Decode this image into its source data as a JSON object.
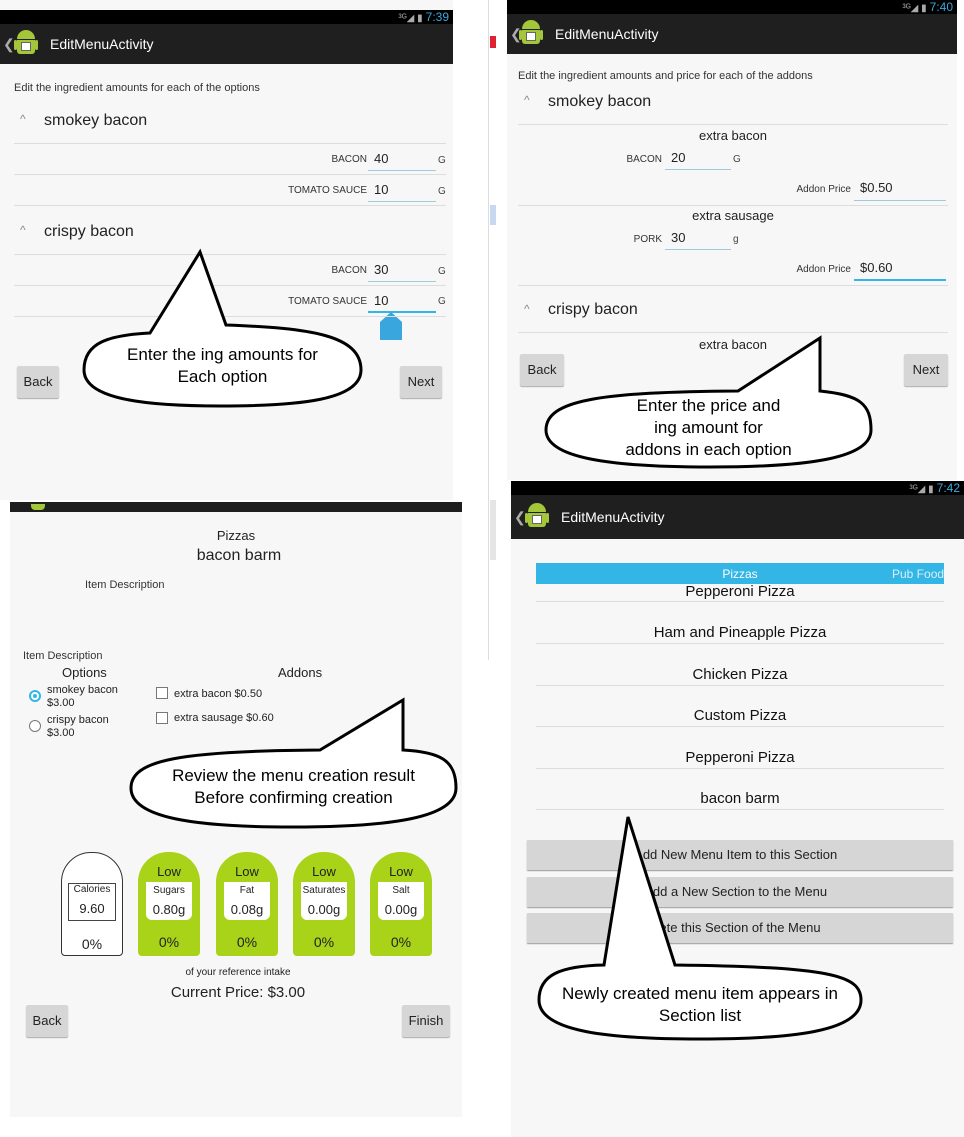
{
  "app_title": "EditMenuActivity",
  "panel1": {
    "status_time": "7:39",
    "instruction": "Edit the ingredient amounts for each of the options",
    "sections": [
      {
        "name": "smokey bacon",
        "rows": [
          {
            "label": "BACON",
            "value": "40",
            "unit": "G"
          },
          {
            "label": "TOMATO SAUCE",
            "value": "10",
            "unit": "G"
          }
        ]
      },
      {
        "name": "crispy bacon",
        "rows": [
          {
            "label": "BACON",
            "value": "30",
            "unit": "G"
          },
          {
            "label": "TOMATO SAUCE",
            "value": "10",
            "unit": "G"
          }
        ]
      }
    ],
    "back_label": "Back",
    "next_label": "Next",
    "callout": "Enter the ing amounts for\nEach option"
  },
  "panel2": {
    "status_time": "7:40",
    "instruction": "Edit the ingredient amounts and price for each of the addons",
    "section1": "smokey bacon",
    "addon1": {
      "name": "extra bacon",
      "ing_label": "BACON",
      "ing_value": "20",
      "unit": "G",
      "price_label": "Addon Price",
      "price": "$0.50"
    },
    "addon2": {
      "name": "extra sausage",
      "ing_label": "PORK",
      "ing_value": "30",
      "unit": "g",
      "price_label": "Addon Price",
      "price": "$0.60"
    },
    "section2": "crispy bacon",
    "addon3": "extra bacon",
    "back_label": "Back",
    "next_label": "Next",
    "callout": "Enter the price and\ning amount for\naddons in each option"
  },
  "panel3": {
    "category": "Pizzas",
    "item_name": "bacon barm",
    "item_description_1": "Item Description",
    "item_description_2": "Item Description",
    "options_header": "Options",
    "addons_header": "Addons",
    "options": [
      {
        "name": "smokey bacon",
        "price": "$3.00",
        "selected": true
      },
      {
        "name": "crispy bacon",
        "price": "$3.00",
        "selected": false
      }
    ],
    "addons": [
      "extra bacon $0.50",
      "extra sausage $0.60"
    ],
    "nutrition": [
      {
        "level": "",
        "name": "Calories",
        "value": "9.60",
        "percent": "0%",
        "color": "#ffffff"
      },
      {
        "level": "Low",
        "name": "Sugars",
        "value": "0.80g",
        "percent": "0%",
        "color": "#a8d318"
      },
      {
        "level": "Low",
        "name": "Fat",
        "value": "0.08g",
        "percent": "0%",
        "color": "#a8d318"
      },
      {
        "level": "Low",
        "name": "Saturates",
        "value": "0.00g",
        "percent": "0%",
        "color": "#a8d318"
      },
      {
        "level": "Low",
        "name": "Salt",
        "value": "0.00g",
        "percent": "0%",
        "color": "#a8d318"
      }
    ],
    "reference_text": "of your reference intake",
    "current_price": "Current Price: $3.00",
    "back_label": "Back",
    "finish_label": "Finish",
    "callout": "Review the menu creation result\nBefore confirming creation"
  },
  "panel4": {
    "status_time": "7:42",
    "tabs": [
      "Pizzas",
      "Pub Food"
    ],
    "items": [
      "Pepperoni Pizza",
      "Ham and Pineapple Pizza",
      "Chicken Pizza",
      "Custom Pizza",
      "Pepperoni Pizza",
      "bacon barm"
    ],
    "buttons": [
      "dd New Menu Item to this Section",
      "dd a New Section to the Menu",
      "ete this Section of the Menu"
    ],
    "callout": "Newly created menu item appears in\nSection list"
  }
}
